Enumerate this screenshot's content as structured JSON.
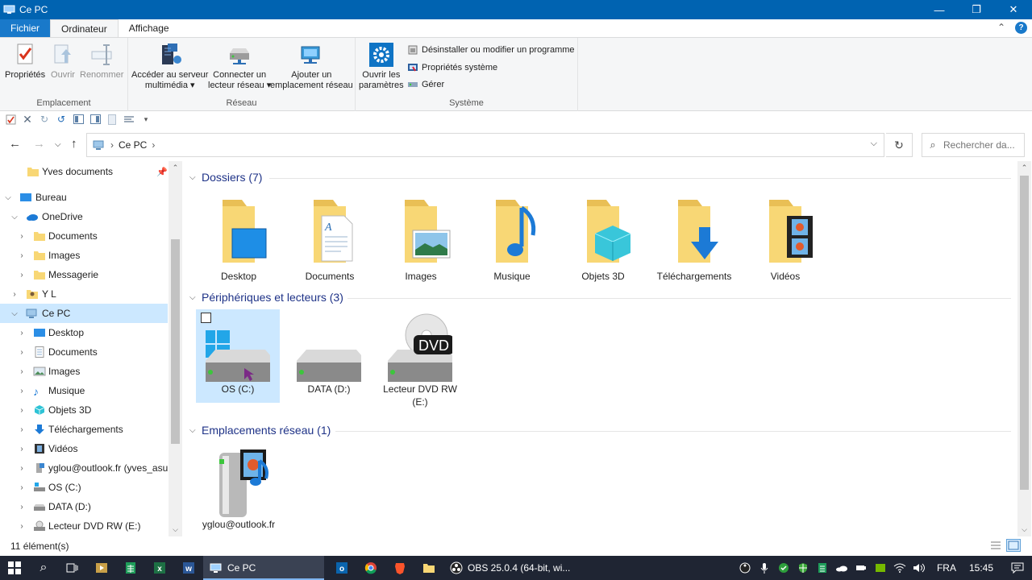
{
  "window": {
    "title": "Ce PC"
  },
  "tabs": {
    "file": "Fichier",
    "computer": "Ordinateur",
    "view": "Affichage"
  },
  "ribbon": {
    "groups": {
      "location": "Emplacement",
      "network": "Réseau",
      "system": "Système"
    },
    "properties": "Propriétés",
    "open": "Ouvrir",
    "rename": "Renommer",
    "media_server_l1": "Accéder au serveur",
    "media_server_l2": "multimédia ▾",
    "map_drive_l1": "Connecter un",
    "map_drive_l2": "lecteur réseau ▾",
    "add_location_l1": "Ajouter un",
    "add_location_l2": "emplacement réseau",
    "open_settings_l1": "Ouvrir les",
    "open_settings_l2": "paramètres",
    "uninstall": "Désinstaller ou modifier un programme",
    "system_props": "Propriétés système",
    "manage": "Gérer"
  },
  "address": {
    "crumb": "Ce PC",
    "separator": "›"
  },
  "search": {
    "placeholder": "Rechercher da..."
  },
  "nav": {
    "items": [
      {
        "label": "Yves documents"
      },
      {
        "label": "Bureau"
      },
      {
        "label": "OneDrive"
      },
      {
        "label": "Documents"
      },
      {
        "label": "Images"
      },
      {
        "label": "Messagerie"
      },
      {
        "label": "Y L"
      },
      {
        "label": "Ce PC"
      },
      {
        "label": "Desktop"
      },
      {
        "label": "Documents"
      },
      {
        "label": "Images"
      },
      {
        "label": "Musique"
      },
      {
        "label": "Objets 3D"
      },
      {
        "label": "Téléchargements"
      },
      {
        "label": "Vidéos"
      },
      {
        "label": "yglou@outlook.fr (yves_asus"
      },
      {
        "label": "OS (C:)"
      },
      {
        "label": "DATA (D:)"
      },
      {
        "label": "Lecteur DVD RW (E:)"
      }
    ]
  },
  "sections": {
    "folders": "Dossiers (7)",
    "devices": "Périphériques et lecteurs (3)",
    "network": "Emplacements réseau (1)"
  },
  "folders": [
    {
      "label": "Desktop"
    },
    {
      "label": "Documents"
    },
    {
      "label": "Images"
    },
    {
      "label": "Musique"
    },
    {
      "label": "Objets 3D"
    },
    {
      "label": "Téléchargements"
    },
    {
      "label": "Vidéos"
    }
  ],
  "drives": [
    {
      "label": "OS (C:)"
    },
    {
      "label": "DATA (D:)"
    },
    {
      "label": "Lecteur DVD RW (E:)",
      "badge": "DVD"
    }
  ],
  "network_items": [
    {
      "label": "yglou@outlook.fr"
    }
  ],
  "status": {
    "count": "11 élément(s)"
  },
  "taskbar": {
    "explorer": "Ce PC",
    "obs": "OBS 25.0.4 (64-bit, wi...",
    "lang": "FRA",
    "clock": "15:45"
  },
  "colors": {
    "accent": "#0063b1",
    "folder": "#f8d775",
    "selection": "#cce8ff",
    "section_title": "#1e3287"
  }
}
